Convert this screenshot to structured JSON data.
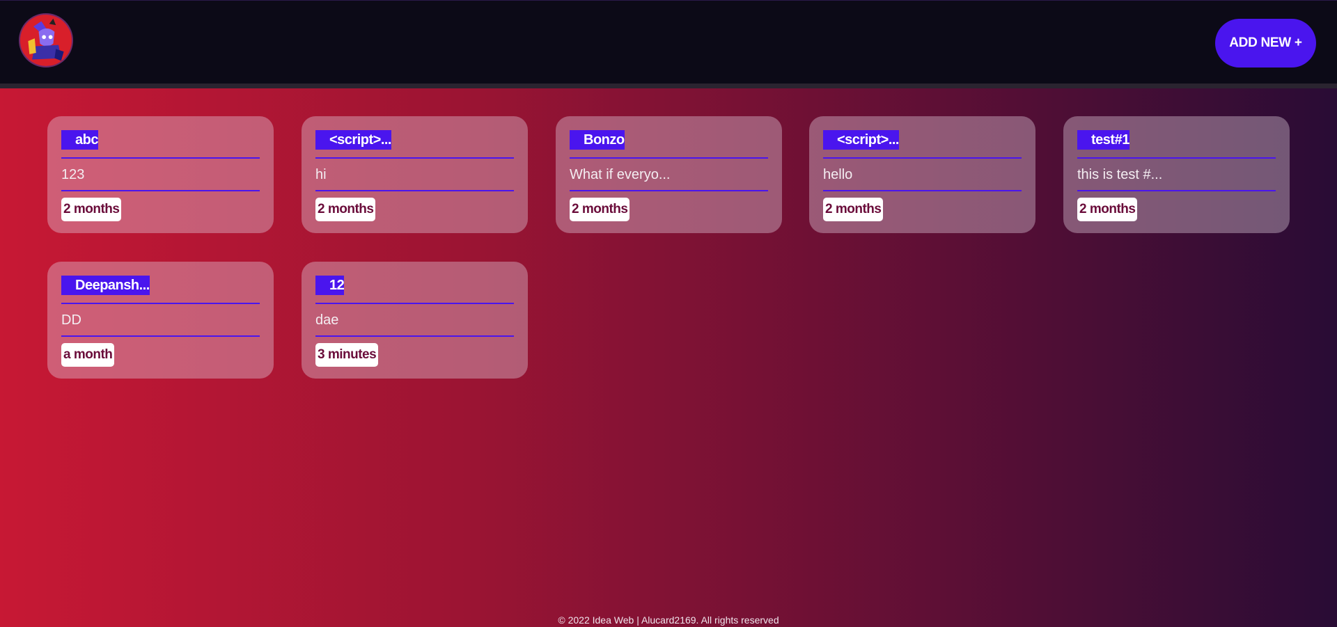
{
  "header": {
    "add_button_label": "ADD NEW +"
  },
  "ideas": [
    {
      "title": "abc",
      "description": "123",
      "time": "2 months"
    },
    {
      "title": "<script>...",
      "description": "hi",
      "time": "2 months"
    },
    {
      "title": "Bonzo",
      "description": "What if everyo...",
      "time": "2 months"
    },
    {
      "title": "<script>...",
      "description": "hello",
      "time": "2 months"
    },
    {
      "title": "test#1",
      "description": "this is test #...",
      "time": "2 months"
    },
    {
      "title": "Deepansh...",
      "description": "DD",
      "time": "a month"
    },
    {
      "title": "12",
      "description": "dae",
      "time": "3 minutes"
    }
  ],
  "footer": {
    "text": "© 2022 Idea Web | Alucard2169. All rights reserved"
  },
  "colors": {
    "accent": "#4a15ee",
    "header_bg": "#0c0a17",
    "gradient_start": "#c71834",
    "gradient_end": "#290c35",
    "time_badge_text": "#6a0c3a"
  },
  "icons": {
    "logo": "avatar-logo-icon"
  }
}
